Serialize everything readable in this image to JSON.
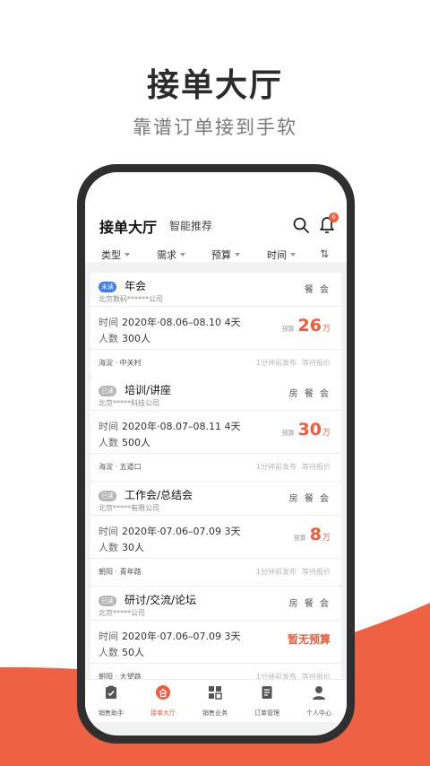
{
  "hero": {
    "title": "接单大厅",
    "subtitle": "靠谱订单接到手软"
  },
  "colors": {
    "accent": "#f15a3a",
    "unread": "#3d7bf0"
  },
  "header": {
    "title": "接单大厅",
    "tab": "智能推荐",
    "search_icon": "search-icon",
    "bell_icon": "bell-icon",
    "bell_badge": "6"
  },
  "filters": [
    "类型",
    "需求",
    "预算",
    "时间"
  ],
  "cards": [
    {
      "status": "未读",
      "name": "年会",
      "company": "北京数码******公司",
      "tags": "餐 会",
      "time_label": "时间",
      "time": "2020年·08.06–08.10 4天",
      "people_label": "人数",
      "people": "300人",
      "budget_label": "预算",
      "budget": "26",
      "budget_unit": "万",
      "location": "海淀 · 中关村",
      "published": "1分钟前发布",
      "state": "等待报价"
    },
    {
      "status": "已读",
      "name": "培训/讲座",
      "company": "北京*****科技公司",
      "tags": "房 餐 会",
      "time_label": "时间",
      "time": "2020年·08.07–08.11 4天",
      "people_label": "人数",
      "people": "500人",
      "budget_label": "预算",
      "budget": "30",
      "budget_unit": "万",
      "location": "海淀 · 五道口",
      "published": "1分钟前发布",
      "state": "等待报价"
    },
    {
      "status": "已读",
      "name": "工作会/总结会",
      "company": "北京*****有限公司",
      "tags": "房 餐 会",
      "time_label": "时间",
      "time": "2020年·07.06–07.09 3天",
      "people_label": "人数",
      "people": "30人",
      "budget_label": "预算",
      "budget": "8",
      "budget_unit": "万",
      "location": "朝阳 · 青年路",
      "published": "1分钟前发布",
      "state": "等待报价"
    },
    {
      "status": "已读",
      "name": "研讨/交流/论坛",
      "company": "北京*****公司",
      "tags": "房 餐 会",
      "time_label": "时间",
      "time": "2020年·07.06–07.09 3天",
      "people_label": "人数",
      "people": "50人",
      "budget_none": "暂无预算",
      "location": "朝阳 · 大望路",
      "published": "1分钟前发布",
      "state": "等待报价"
    }
  ],
  "tabbar": [
    {
      "label": "销售助手",
      "icon": "clipboard-icon"
    },
    {
      "label": "接单大厅",
      "icon": "hall-icon",
      "active": true
    },
    {
      "label": "销售业务",
      "icon": "grid-icon"
    },
    {
      "label": "订单管理",
      "icon": "document-icon"
    },
    {
      "label": "个人中心",
      "icon": "person-icon"
    }
  ]
}
